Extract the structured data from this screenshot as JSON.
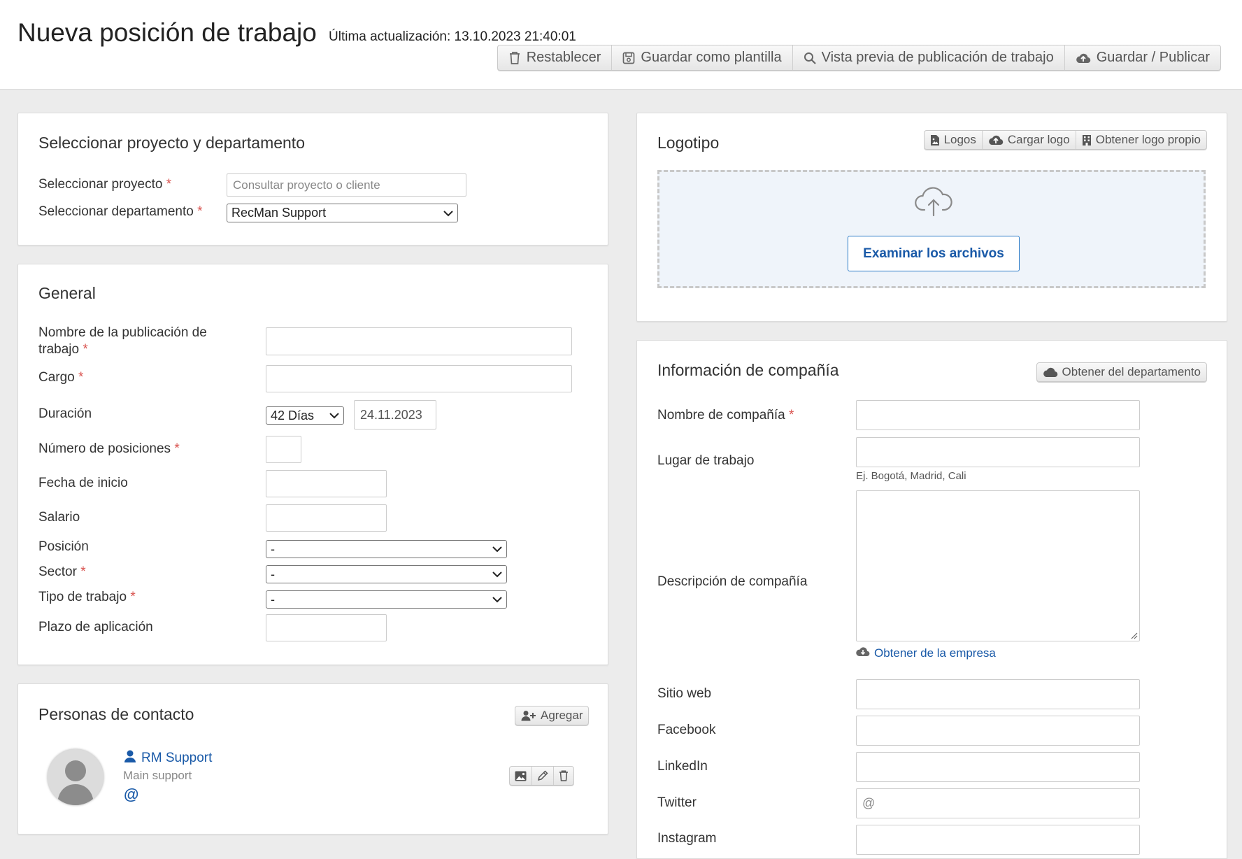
{
  "header": {
    "title": "Nueva posición de trabajo",
    "last_updated": "Última actualización: 13.10.2023 21:40:01",
    "actions": {
      "reset": "Restablecer",
      "save_template": "Guardar como plantilla",
      "preview": "Vista previa de publicación de trabajo",
      "save_publish": "Guardar / Publicar"
    }
  },
  "project": {
    "title": "Seleccionar proyecto y departamento",
    "project_label": "Seleccionar proyecto",
    "project_placeholder": "Consultar proyecto o cliente",
    "department_label": "Seleccionar departamento",
    "department_value": "RecMan Support"
  },
  "general": {
    "title": "General",
    "job_posting_name_label_1": "Nombre de la publicación de",
    "job_posting_name_label_2": "trabajo",
    "position_title_label": "Cargo",
    "duration_label": "Duración",
    "duration_value": "42 Días",
    "duration_end_date": "24.11.2023",
    "positions_count_label": "Número de posiciones",
    "start_date_label": "Fecha de inicio",
    "salary_label": "Salario",
    "position_label": "Posición",
    "position_value": "-",
    "sector_label": "Sector",
    "sector_value": "-",
    "job_type_label": "Tipo de trabajo",
    "job_type_value": "-",
    "deadline_label": "Plazo de aplicación"
  },
  "contacts": {
    "title": "Personas de contacto",
    "add_label": "Agregar",
    "items": [
      {
        "name": "RM Support",
        "role": "Main support",
        "email_symbol": "@"
      }
    ]
  },
  "logo": {
    "title": "Logotipo",
    "actions": {
      "logos": "Logos",
      "upload": "Cargar logo",
      "own": "Obtener logo propio"
    },
    "browse_label": "Examinar los archivos"
  },
  "company": {
    "title": "Información de compañía",
    "fetch_department_label": "Obtener del departamento",
    "name_label": "Nombre de compañía",
    "workplace_label": "Lugar de trabajo",
    "workplace_hint": "Ej. Bogotá, Madrid, Cali",
    "description_label": "Descripción de compañía",
    "fetch_company_label": "Obtener de la empresa",
    "website_label": "Sitio web",
    "facebook_label": "Facebook",
    "linkedin_label": "LinkedIn",
    "twitter_label": "Twitter",
    "twitter_prefix": "@",
    "instagram_label": "Instagram"
  },
  "colors": {
    "accent": "#1a5aa8",
    "required": "#d9534f",
    "background": "#ececec"
  }
}
